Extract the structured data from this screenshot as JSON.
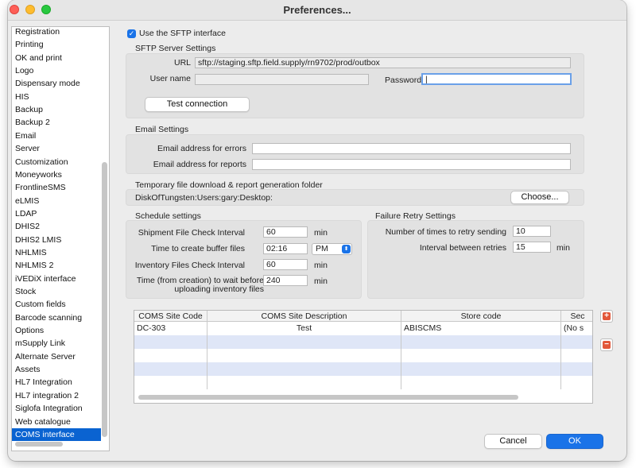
{
  "window": {
    "title": "Preferences..."
  },
  "sidebar": {
    "items": [
      {
        "label": "Registration"
      },
      {
        "label": "Printing"
      },
      {
        "label": "OK and print"
      },
      {
        "label": "Logo"
      },
      {
        "label": "Dispensary mode"
      },
      {
        "label": "HIS"
      },
      {
        "label": "Backup"
      },
      {
        "label": "Backup 2"
      },
      {
        "label": "Email"
      },
      {
        "label": "Server"
      },
      {
        "label": "Customization"
      },
      {
        "label": "Moneyworks"
      },
      {
        "label": "FrontlineSMS"
      },
      {
        "label": "eLMIS"
      },
      {
        "label": "LDAP"
      },
      {
        "label": "DHIS2"
      },
      {
        "label": "DHIS2 LMIS"
      },
      {
        "label": "NHLMIS"
      },
      {
        "label": "NHLMIS 2"
      },
      {
        "label": "iVEDiX interface"
      },
      {
        "label": "Stock"
      },
      {
        "label": "Custom fields"
      },
      {
        "label": "Barcode scanning"
      },
      {
        "label": "Options"
      },
      {
        "label": "mSupply Link"
      },
      {
        "label": "Alternate Server"
      },
      {
        "label": "Assets"
      },
      {
        "label": "HL7 Integration"
      },
      {
        "label": "HL7 integration 2"
      },
      {
        "label": "Siglofa Integration"
      },
      {
        "label": "Web catalogue"
      },
      {
        "label": "COMS interface"
      }
    ],
    "selected": "COMS interface"
  },
  "sftp": {
    "use_label": "Use the SFTP interface",
    "use_checked": true,
    "section_title": "SFTP Server Settings",
    "url_label": "URL",
    "url_value": "sftp://staging.sftp.field.supply/rn9702/prod/outbox",
    "username_label": "User name",
    "username_value": "",
    "password_label": "Password",
    "password_value": "|",
    "test_button": "Test connection"
  },
  "email": {
    "section_title": "Email Settings",
    "errors_label": "Email address for errors",
    "errors_value": "",
    "reports_label": "Email address for reports",
    "reports_value": ""
  },
  "temp_folder": {
    "section_title": "Temporary file download & report generation folder",
    "path": "DiskOfTungsten:Users:gary:Desktop:",
    "choose_button": "Choose..."
  },
  "schedule": {
    "section_title": "Schedule settings",
    "shipment_label": "Shipment File Check Interval",
    "shipment_value": "60",
    "shipment_unit": "min",
    "buffer_label": "Time to create buffer files",
    "buffer_value": "02:16",
    "buffer_ampm": "PM",
    "inventory_label": "Inventory Files Check Interval",
    "inventory_value": "60",
    "inventory_unit": "min",
    "wait_label_1": "Time (from creation) to wait before",
    "wait_label_2": "uploading inventory files",
    "wait_value": "240",
    "wait_unit": "min"
  },
  "retry": {
    "section_title": "Failure Retry Settings",
    "times_label": "Number of times to retry sending",
    "times_value": "10",
    "interval_label": "Interval between retries",
    "interval_value": "15",
    "interval_unit": "min"
  },
  "table": {
    "columns": [
      "COMS Site Code",
      "COMS Site Description",
      "Store code",
      "Sec"
    ],
    "rows": [
      [
        "DC-303",
        "Test",
        "ABISCMS",
        "(No s"
      ]
    ]
  },
  "buttons": {
    "cancel": "Cancel",
    "ok": "OK",
    "add_icon": "plus-icon",
    "remove_icon": "minus-icon"
  },
  "colors": {
    "accent": "#1a73e8",
    "selection": "#0a63d1",
    "row_alt": "#dfe6f7",
    "add_remove": "#e2583a"
  }
}
